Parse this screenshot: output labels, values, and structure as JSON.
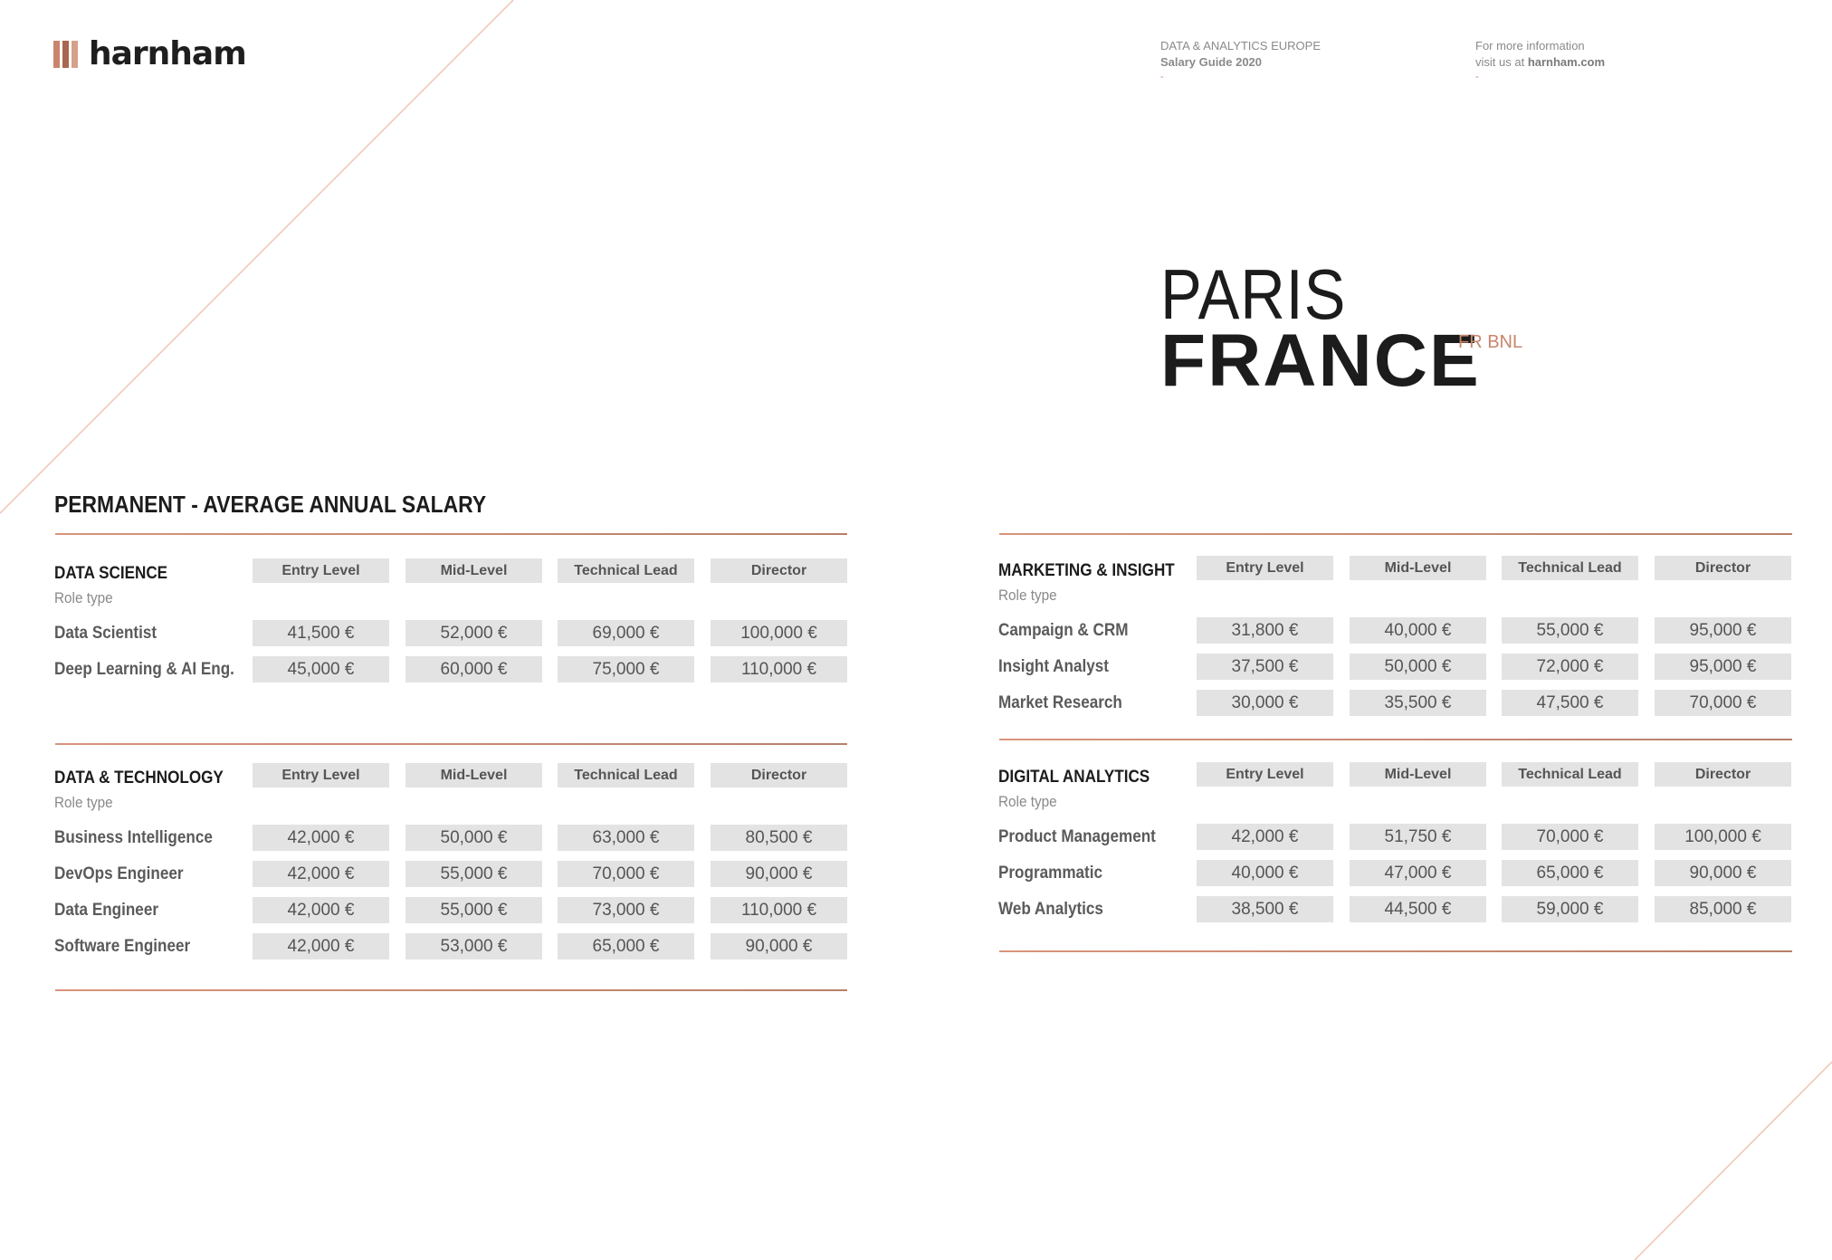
{
  "brand": {
    "logo_text": "harnham",
    "accent": "#c8856c"
  },
  "header": {
    "guide_line1": "DATA & ANALYTICS EUROPE",
    "guide_line2": "Salary Guide 2020",
    "info_line1": "For more information",
    "info_line2_prefix": "visit us at",
    "info_site": "harnham.com",
    "dash": "-"
  },
  "city": {
    "name": "PARIS",
    "country": "FRANCE",
    "region": "FR BNL"
  },
  "page_title": "PERMANENT - AVERAGE  ANNUAL SALARY",
  "columns": [
    "Entry Level",
    "Mid-Level",
    "Technical Lead",
    "Director"
  ],
  "role_type_label": "Role type",
  "tables": {
    "data_science": {
      "title": "DATA SCIENCE",
      "rows": [
        {
          "role": "Data Scientist",
          "values": [
            "41,500 €",
            "52,000 €",
            "69,000 €",
            "100,000 €"
          ]
        },
        {
          "role": "Deep Learning & AI Eng.",
          "values": [
            "45,000 €",
            "60,000 €",
            "75,000 €",
            "110,000 €"
          ]
        }
      ]
    },
    "data_technology": {
      "title": "DATA & TECHNOLOGY",
      "rows": [
        {
          "role": "Business Intelligence",
          "values": [
            "42,000 €",
            "50,000 €",
            "63,000 €",
            "80,500 €"
          ]
        },
        {
          "role": "DevOps Engineer",
          "values": [
            "42,000 €",
            "55,000 €",
            "70,000 €",
            "90,000 €"
          ]
        },
        {
          "role": "Data Engineer",
          "values": [
            "42,000 €",
            "55,000 €",
            "73,000 €",
            "110,000 €"
          ]
        },
        {
          "role": "Software Engineer",
          "values": [
            "42,000 €",
            "53,000 €",
            "65,000 €",
            "90,000 €"
          ]
        }
      ]
    },
    "marketing_insight": {
      "title": "MARKETING & INSIGHT",
      "rows": [
        {
          "role": "Campaign & CRM",
          "values": [
            "31,800 €",
            "40,000 €",
            "55,000 €",
            "95,000 €"
          ]
        },
        {
          "role": "Insight Analyst",
          "values": [
            "37,500 €",
            "50,000 €",
            "72,000 €",
            "95,000 €"
          ]
        },
        {
          "role": "Market Research",
          "values": [
            "30,000 €",
            "35,500 €",
            "47,500 €",
            "70,000 €"
          ]
        }
      ]
    },
    "digital_analytics": {
      "title": "DIGITAL ANALYTICS",
      "rows": [
        {
          "role": "Product Management",
          "values": [
            "42,000 €",
            "51,750 €",
            "70,000 €",
            "100,000 €"
          ]
        },
        {
          "role": "Programmatic",
          "values": [
            "40,000 €",
            "47,000 €",
            "65,000 €",
            "90,000 €"
          ]
        },
        {
          "role": "Web Analytics",
          "values": [
            "38,500 €",
            "44,500 €",
            "59,000 €",
            "85,000 €"
          ]
        }
      ]
    }
  }
}
